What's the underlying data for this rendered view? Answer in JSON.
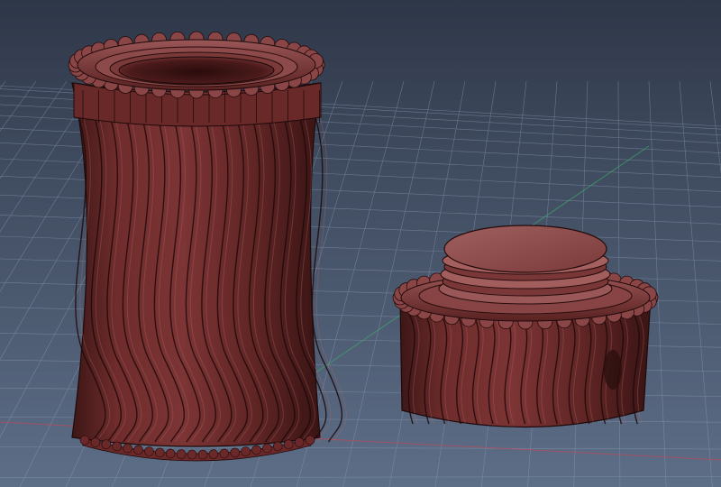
{
  "viewport": {
    "view": "perspective",
    "background_top": "#2e3748",
    "background_bottom": "#5b6c85",
    "grid": true,
    "grid_color": "#8ea0bb",
    "x_axis_color": "#c0485a",
    "y_axis_color": "#3ea86a"
  },
  "model": {
    "material_color": "#6e2a2a",
    "highlight_color": "#b06a6a",
    "edge_color": "#1e0a0a",
    "parts": [
      {
        "name": "container-body",
        "feature": "twisted-flutes",
        "rim": "knurled"
      },
      {
        "name": "screw-cap",
        "feature": "external-thread",
        "rim": "knurled"
      }
    ]
  }
}
